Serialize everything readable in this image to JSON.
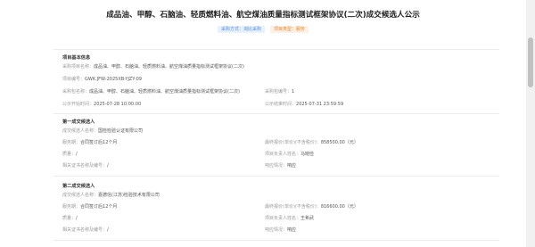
{
  "header": {
    "title": "成品油、甲醇、石脑油、轻质燃料油、航空煤油质量指标测试框架协议(二次)成交候选人公示",
    "tags": [
      {
        "label": "采购方式：询比采购",
        "color": "#5b8fd6"
      },
      {
        "label": "项目类型：服务",
        "color": "#e08a3c"
      }
    ]
  },
  "basic_info": {
    "title": "项目基本信息",
    "project_name_label": "采购项目名称：",
    "project_name": "成品油、甲醇、石脑油、轻质燃料油、航空煤油质量指标测试框架协议(二次)",
    "project_no_label": "项目编号：",
    "project_no": "GWK.JFW-2025XB-YJZY-09",
    "package_name_label": "采购包名称：",
    "package_name": "成品油、甲醇、石脑油、轻质燃料油、航空煤油质量指标测试框架协议(二次)",
    "package_no_label": "采购包编号：",
    "package_no": "1",
    "start_label": "公示开始时间：",
    "start_time": "2025-07-28 10:00:00",
    "end_label": "公示结束时间：",
    "end_time": "2025-07-31 23:59:59"
  },
  "candidate1": {
    "title": "第一成交候选人",
    "name_label": "成交候选人名称：",
    "name": "国检检验认证有限公司",
    "term_label": "服务期：",
    "term": "合同签订后12个月",
    "price_label": "最终报价(单价)(不含税价)：",
    "price": "858500.00（元）",
    "quality_label": "质量：",
    "quality": "/",
    "manager_label": "项目负责人姓名：",
    "manager": "马晓俭",
    "cert_label": "相关证书名称及编号：",
    "cert": "/",
    "response_label": "响应情况：",
    "response": "响应"
  },
  "candidate2": {
    "title": "第二成交候选人",
    "name_label": "成交候选人名称：",
    "name": "嘉德信(江苏)检验技术有限公司",
    "term_label": "服务期：",
    "term": "合同签订后12个月",
    "price_label": "最终报价(单价)(不含税价)：",
    "price": "816600.00（元）",
    "quality_label": "质量：",
    "quality": "/",
    "manager_label": "项目负责人姓名：",
    "manager": "王希武",
    "cert_label": "相关证书名称及编号：",
    "cert": "/",
    "response_label": "响应情况：",
    "response": "响应"
  }
}
